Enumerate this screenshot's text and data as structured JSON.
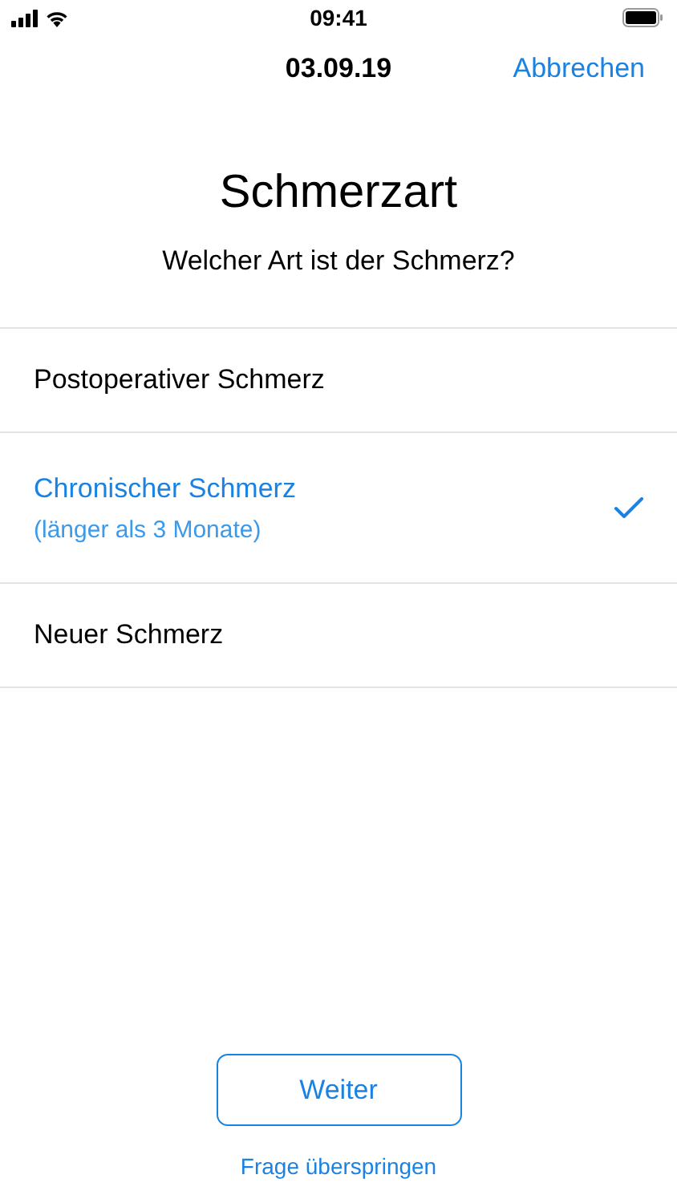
{
  "status_bar": {
    "time": "09:41"
  },
  "nav_bar": {
    "title": "03.09.19",
    "cancel": "Abbrechen"
  },
  "question": {
    "title": "Schmerzart",
    "subtitle": "Welcher Art ist der Schmerz?"
  },
  "options": [
    {
      "label": "Postoperativer Schmerz",
      "selected": false
    },
    {
      "label": "Chronischer Schmerz",
      "detail": "(länger als 3 Monate)",
      "selected": true
    },
    {
      "label": "Neuer Schmerz",
      "selected": false
    }
  ],
  "next_button": "Weiter",
  "skip_link": "Frage überspringen"
}
